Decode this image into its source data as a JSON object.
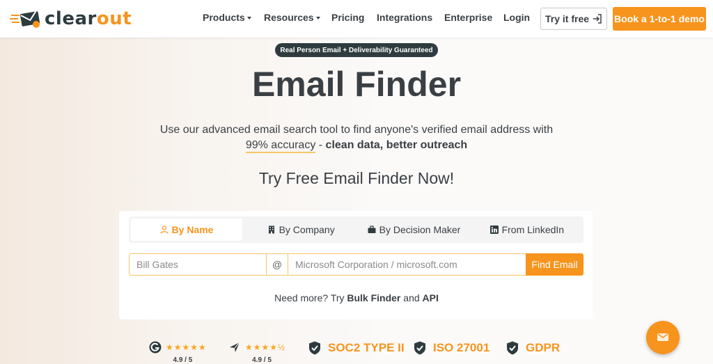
{
  "nav": {
    "logo_text_dark": "clear",
    "logo_text_accent": "out",
    "items": [
      {
        "label": "Products",
        "has_dropdown": true
      },
      {
        "label": "Resources",
        "has_dropdown": true
      },
      {
        "label": "Pricing",
        "has_dropdown": false
      },
      {
        "label": "Integrations",
        "has_dropdown": false
      },
      {
        "label": "Enterprise",
        "has_dropdown": false
      },
      {
        "label": "Login",
        "has_dropdown": false
      }
    ],
    "try_button": "Try it free",
    "demo_button": "Book a 1-to-1 demo"
  },
  "hero": {
    "badge": "Real Person Email + Deliverability Guaranteed",
    "title": "Email Finder",
    "subtitle_line1": "Use our advanced email search tool to find anyone's verified email address with",
    "subtitle_accuracy": "99% accuracy",
    "subtitle_dash": " - ",
    "subtitle_bold": "clean data, better outreach",
    "cta": "Try Free Email Finder Now!"
  },
  "finder": {
    "tabs": [
      {
        "label": "By Name",
        "icon": "user-icon",
        "active": true
      },
      {
        "label": "By Company",
        "icon": "building-icon",
        "active": false
      },
      {
        "label": "By Decision Maker",
        "icon": "briefcase-icon",
        "active": false
      },
      {
        "label": "From LinkedIn",
        "icon": "linkedin-icon",
        "active": false
      }
    ],
    "name_placeholder": "Bill Gates",
    "at_symbol": "@",
    "company_placeholder": "Microsoft Corporation / microsoft.com",
    "find_button": "Find Email",
    "need_more_prefix": "Need more? Try ",
    "bulk_link": "Bulk Finder",
    "and_text": " and ",
    "api_link": "API"
  },
  "trust": {
    "ratings": [
      {
        "icon": "g2-icon",
        "value": "4.9 / 5"
      },
      {
        "icon": "capterra-icon",
        "value": "4.9 / 5"
      }
    ],
    "certs": [
      "SOC2 TYPE II",
      "ISO 27001",
      "GDPR"
    ]
  },
  "colors": {
    "accent": "#f7941d",
    "dark": "#2e3b3f"
  }
}
